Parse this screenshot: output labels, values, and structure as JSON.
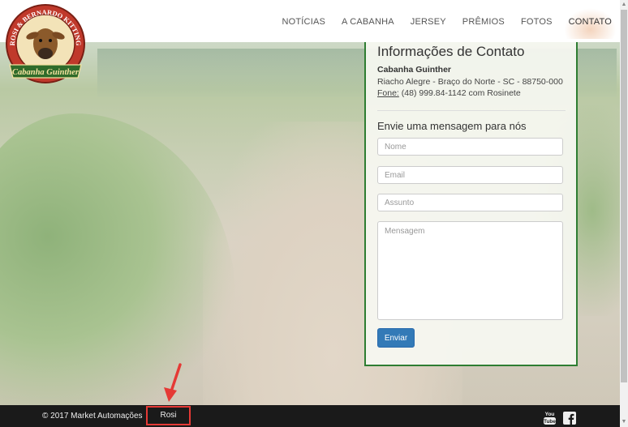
{
  "brand": {
    "logo_text_top": "ROSI & BERNARDO KITTING",
    "logo_text_bottom": "Cabanha Guinther"
  },
  "nav": {
    "items": [
      {
        "label": "NOTÍCIAS"
      },
      {
        "label": "A CABANHA"
      },
      {
        "label": "JERSEY"
      },
      {
        "label": "PRÊMIOS"
      },
      {
        "label": "FOTOS"
      },
      {
        "label": "CONTATO"
      }
    ],
    "active": "CONTATO"
  },
  "contact": {
    "title": "Informações de Contato",
    "company": "Cabanha Guinther",
    "address": "Riacho Alegre - Braço do Norte - SC - 88750-000",
    "phone_label": "Fone:",
    "phone_value": "(48) 999.84-1142 com Rosinete"
  },
  "form": {
    "title": "Envie uma mensagem para nós",
    "name_placeholder": "Nome",
    "email_placeholder": "Email",
    "subject_placeholder": "Assunto",
    "message_placeholder": "Mensagem",
    "submit_label": "Enviar"
  },
  "footer": {
    "copyright": "© 2017 Market Automações",
    "highlighted_link": "Rosi",
    "social": [
      "youtube-icon",
      "facebook-icon"
    ]
  },
  "colors": {
    "panel_border": "#2e7d32",
    "button": "#337ab7",
    "footer_bg": "#1a1a1a",
    "highlight_border": "#e53935",
    "arrow": "#e53935"
  }
}
